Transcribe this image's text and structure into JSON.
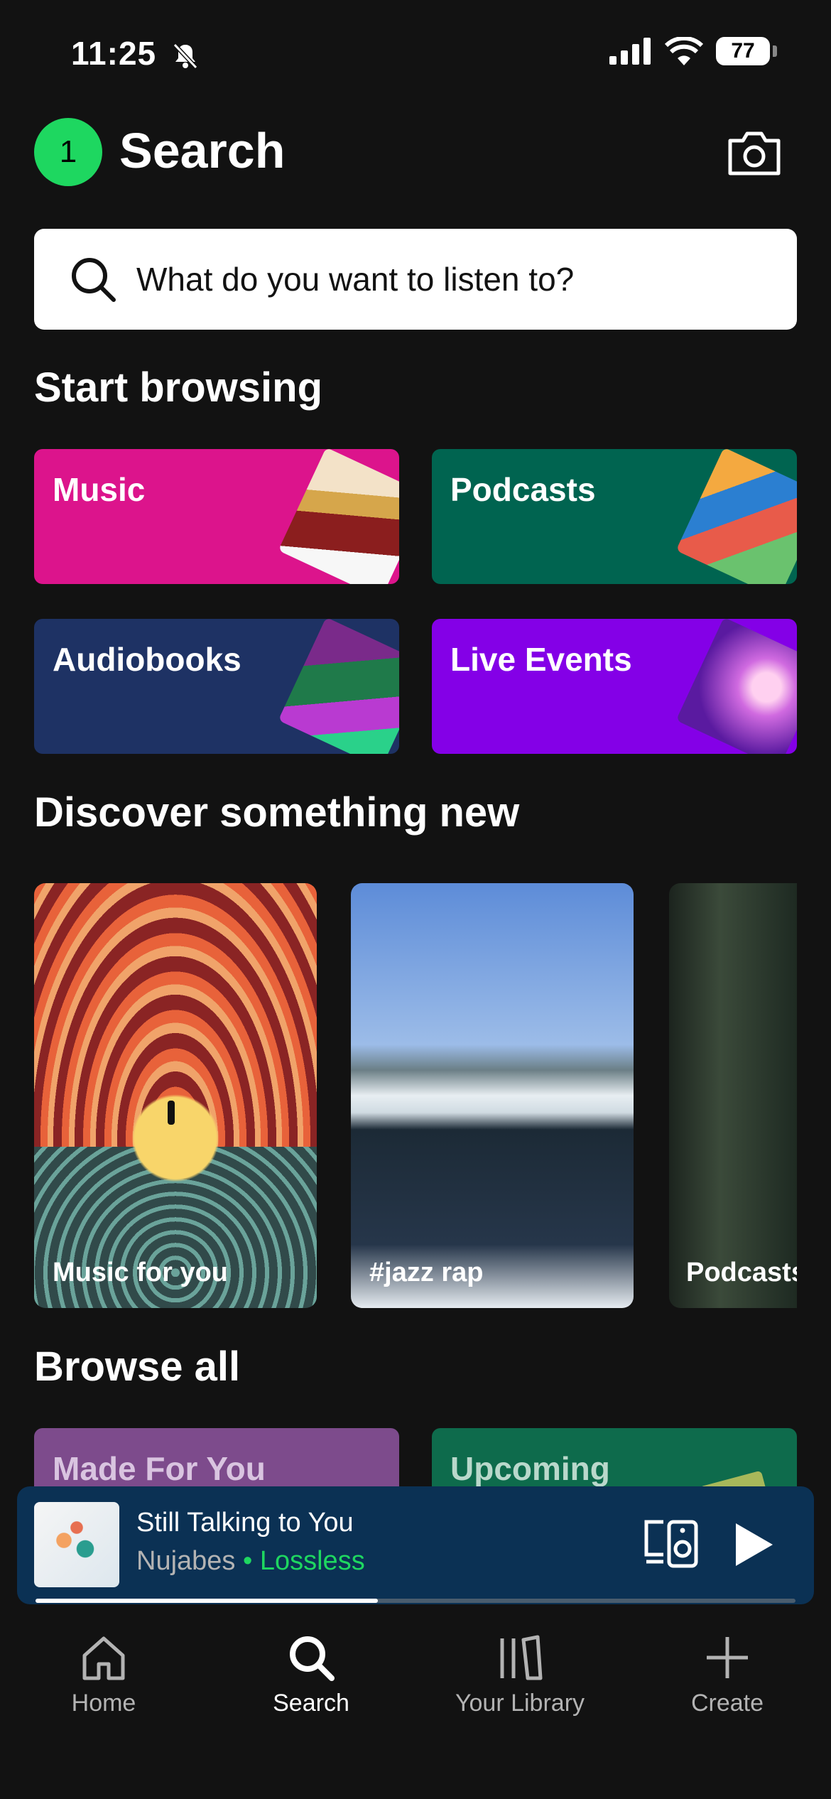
{
  "status_bar": {
    "time": "11:25",
    "battery": "77"
  },
  "header": {
    "avatar_letter": "1",
    "title": "Search"
  },
  "search": {
    "placeholder": "What do you want to listen to?"
  },
  "start_browsing": {
    "title": "Start browsing",
    "tiles": [
      {
        "label": "Music",
        "color": "#dc148c"
      },
      {
        "label": "Podcasts",
        "color": "#006450"
      },
      {
        "label": "Audiobooks",
        "color": "#1e3264"
      },
      {
        "label": "Live Events",
        "color": "#8400e7"
      }
    ]
  },
  "discover": {
    "title": "Discover something new",
    "cards": [
      {
        "label": "Music for you"
      },
      {
        "label": "#jazz rap"
      },
      {
        "label": "Podcasts"
      }
    ]
  },
  "browse_all": {
    "title": "Browse all",
    "tiles": [
      {
        "label": "Made For You",
        "color": "#7d4b8c"
      },
      {
        "label": "Upcoming",
        "color": "#0e6b4c"
      }
    ]
  },
  "player": {
    "track": "Still Talking to You",
    "artist": "Nujabes",
    "quality": "• Lossless",
    "progress": 0.45
  },
  "nav": [
    {
      "label": "Home"
    },
    {
      "label": "Search"
    },
    {
      "label": "Your Library"
    },
    {
      "label": "Create"
    }
  ],
  "colors": {
    "accent": "#1ed760",
    "background": "#121212",
    "player_bg": "#0b3154"
  }
}
